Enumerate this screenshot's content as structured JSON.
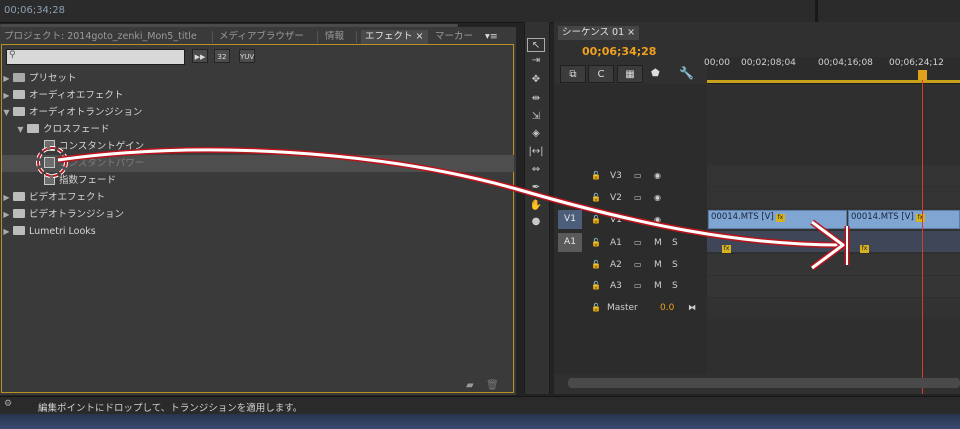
{
  "source_monitor": {
    "timecode": "00;06;34;28"
  },
  "project_panel": {
    "tabs": [
      {
        "label": "プロジェクト: 2014goto_zenki_Mon5_title"
      },
      {
        "label": "メディアブラウザー"
      },
      {
        "label": "情報"
      },
      {
        "label": "エフェクト"
      },
      {
        "label": "マーカー"
      }
    ],
    "active_tab": "エフェクト",
    "search_placeholder": "",
    "toolbar_icons": [
      "accelerated-icon",
      "32-bit-icon",
      "yuv-icon"
    ],
    "tree": [
      {
        "label": "プリセット",
        "expanded": false,
        "level": 0
      },
      {
        "label": "オーディオエフェクト",
        "expanded": false,
        "level": 0
      },
      {
        "label": "オーディオトランジション",
        "expanded": true,
        "level": 0
      },
      {
        "label": "クロスフェード",
        "expanded": true,
        "level": 1
      },
      {
        "label": "コンスタントゲイン",
        "level": 2
      },
      {
        "label": "コンスタントパワー",
        "level": 2,
        "selected": true
      },
      {
        "label": "指数フェード",
        "level": 2
      },
      {
        "label": "ビデオエフェクト",
        "expanded": false,
        "level": 0
      },
      {
        "label": "ビデオトランジション",
        "expanded": false,
        "level": 0
      },
      {
        "label": "Lumetri Looks",
        "expanded": false,
        "level": 0
      }
    ]
  },
  "sequence": {
    "tab": "シーケンス 01",
    "timecode": "00;06;34;28",
    "ruler_labels": [
      "00;00",
      "00;02;08;04",
      "00;04;16;08",
      "00;06;24;12"
    ],
    "tracks": [
      {
        "name": "V3",
        "type": "video"
      },
      {
        "name": "V2",
        "type": "video"
      },
      {
        "name": "V1",
        "type": "video",
        "source": "V1"
      },
      {
        "name": "A1",
        "type": "audio",
        "source": "A1",
        "m": "M",
        "s": "S"
      },
      {
        "name": "A2",
        "type": "audio",
        "m": "M",
        "s": "S"
      },
      {
        "name": "A3",
        "type": "audio",
        "m": "M",
        "s": "S"
      }
    ],
    "master": {
      "label": "Master",
      "value": "0.0"
    },
    "clips_v1": [
      "00014.MTS [V]",
      "00014.MTS [V]"
    ],
    "fx_label": "fx"
  },
  "status": {
    "text": "編集ポイントにドロップして、トランジションを適用します。"
  },
  "colors": {
    "accent": "#f0a11d",
    "playhead": "#d83c2d",
    "clip": "#7fa5d3",
    "arrow": "#ffffff",
    "arrow_outline": "#b8141c"
  }
}
